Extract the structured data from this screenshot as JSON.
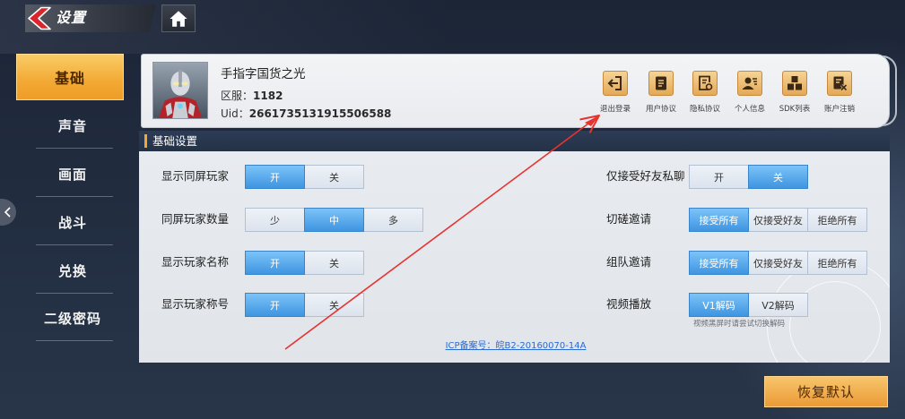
{
  "header": {
    "title": "设置"
  },
  "sidebar": {
    "items": [
      "基础",
      "声音",
      "画面",
      "战斗",
      "兑换",
      "二级密码"
    ],
    "selected": 0
  },
  "profile": {
    "name": "手指字国货之光",
    "server_label": "区服：",
    "server": "1182",
    "uid_label": "Uid：",
    "uid": "2661735131915506588"
  },
  "profile_actions": [
    {
      "label": "退出登录",
      "icon": "logout-icon"
    },
    {
      "label": "用户协议",
      "icon": "user-agreement-icon"
    },
    {
      "label": "隐私协议",
      "icon": "privacy-agreement-icon"
    },
    {
      "label": "个人信息",
      "icon": "personal-info-icon"
    },
    {
      "label": "SDK列表",
      "icon": "sdk-list-icon"
    },
    {
      "label": "账户注销",
      "icon": "account-cancel-icon"
    }
  ],
  "section": {
    "title": "基础设置"
  },
  "settings_left": [
    {
      "label": "显示同屏玩家",
      "options": [
        "开",
        "关"
      ],
      "selected": 0
    },
    {
      "label": "同屏玩家数量",
      "options": [
        "少",
        "中",
        "多"
      ],
      "selected": 1
    },
    {
      "label": "显示玩家名称",
      "options": [
        "开",
        "关"
      ],
      "selected": 0
    },
    {
      "label": "显示玩家称号",
      "options": [
        "开",
        "关"
      ],
      "selected": 0
    }
  ],
  "settings_right": [
    {
      "label": "仅接受好友私聊",
      "options": [
        "开",
        "关"
      ],
      "selected": 1
    },
    {
      "label": "切磋邀请",
      "options": [
        "接受所有",
        "仅接受好友",
        "拒绝所有"
      ],
      "selected": 0
    },
    {
      "label": "组队邀请",
      "options": [
        "接受所有",
        "仅接受好友",
        "拒绝所有"
      ],
      "selected": 0
    },
    {
      "label": "视频播放",
      "options": [
        "V1解码",
        "V2解码"
      ],
      "selected": 0,
      "hint": "视频黑屏时请尝试切换解码"
    }
  ],
  "icp": "ICP备案号：皖B2-20160070-14A",
  "reset_label": "恢复默认",
  "colors": {
    "accent_orange": "#f2a934",
    "selected_blue": "#4a9fe6",
    "link_blue": "#2a6bd1",
    "annotation_red": "#e8322f",
    "header_navy": "#283750"
  }
}
